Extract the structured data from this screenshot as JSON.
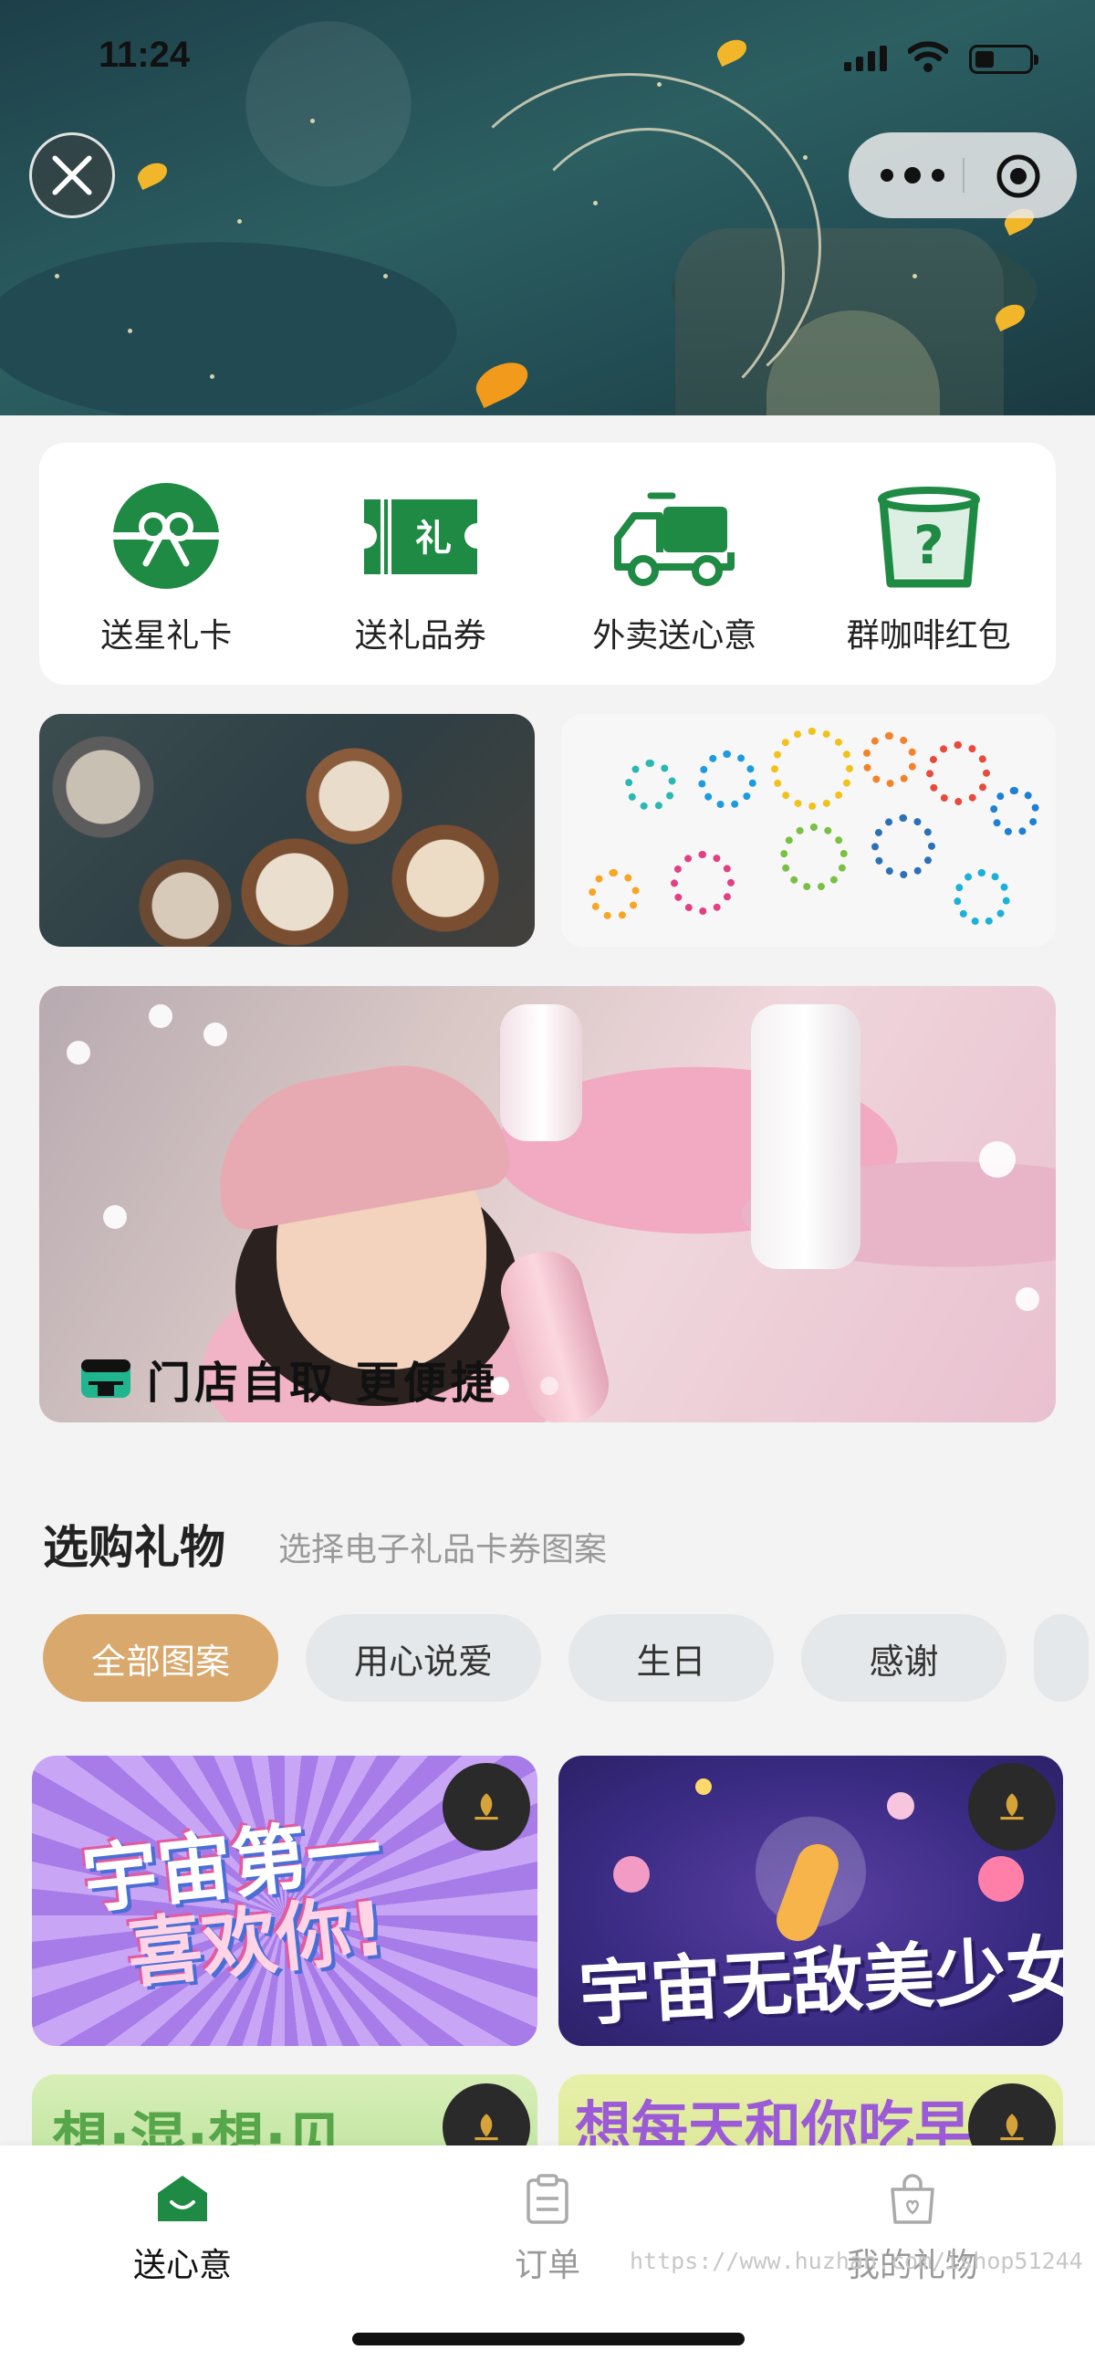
{
  "status_bar": {
    "time": "11:24"
  },
  "quick_actions": [
    {
      "label": "送星礼卡",
      "icon": "gift-card-icon"
    },
    {
      "label": "送礼品券",
      "icon": "ticket-icon"
    },
    {
      "label": "外卖送心意",
      "icon": "delivery-truck-icon"
    },
    {
      "label": "群咖啡红包",
      "icon": "mystery-cup-icon"
    }
  ],
  "banner": {
    "caption": "门店自取 更便捷",
    "slides": 2,
    "active_slide": 0
  },
  "gift_section": {
    "title": "选购礼物",
    "subtitle": "选择电子礼品卡券图案",
    "categories": [
      "全部图案",
      "用心说爱",
      "生日",
      "感谢"
    ],
    "active_category": 0
  },
  "gift_cards": [
    {
      "title_line1": "宇宙第一",
      "title_line2": "喜欢你!"
    },
    {
      "title": "宇宙无敌美少女"
    },
    {
      "title": "想·混·想·见"
    },
    {
      "title": "想每天和你吃早餐"
    }
  ],
  "tabbar": [
    {
      "label": "送心意",
      "active": true
    },
    {
      "label": "订单",
      "active": false
    },
    {
      "label": "我的礼物",
      "active": false
    }
  ],
  "watermark": "https://www.huzhan.com/ishop51244",
  "colors": {
    "brand_green": "#1e8a43",
    "chip_active": "#d9a86c",
    "chip_inactive": "#e5e8ea"
  }
}
